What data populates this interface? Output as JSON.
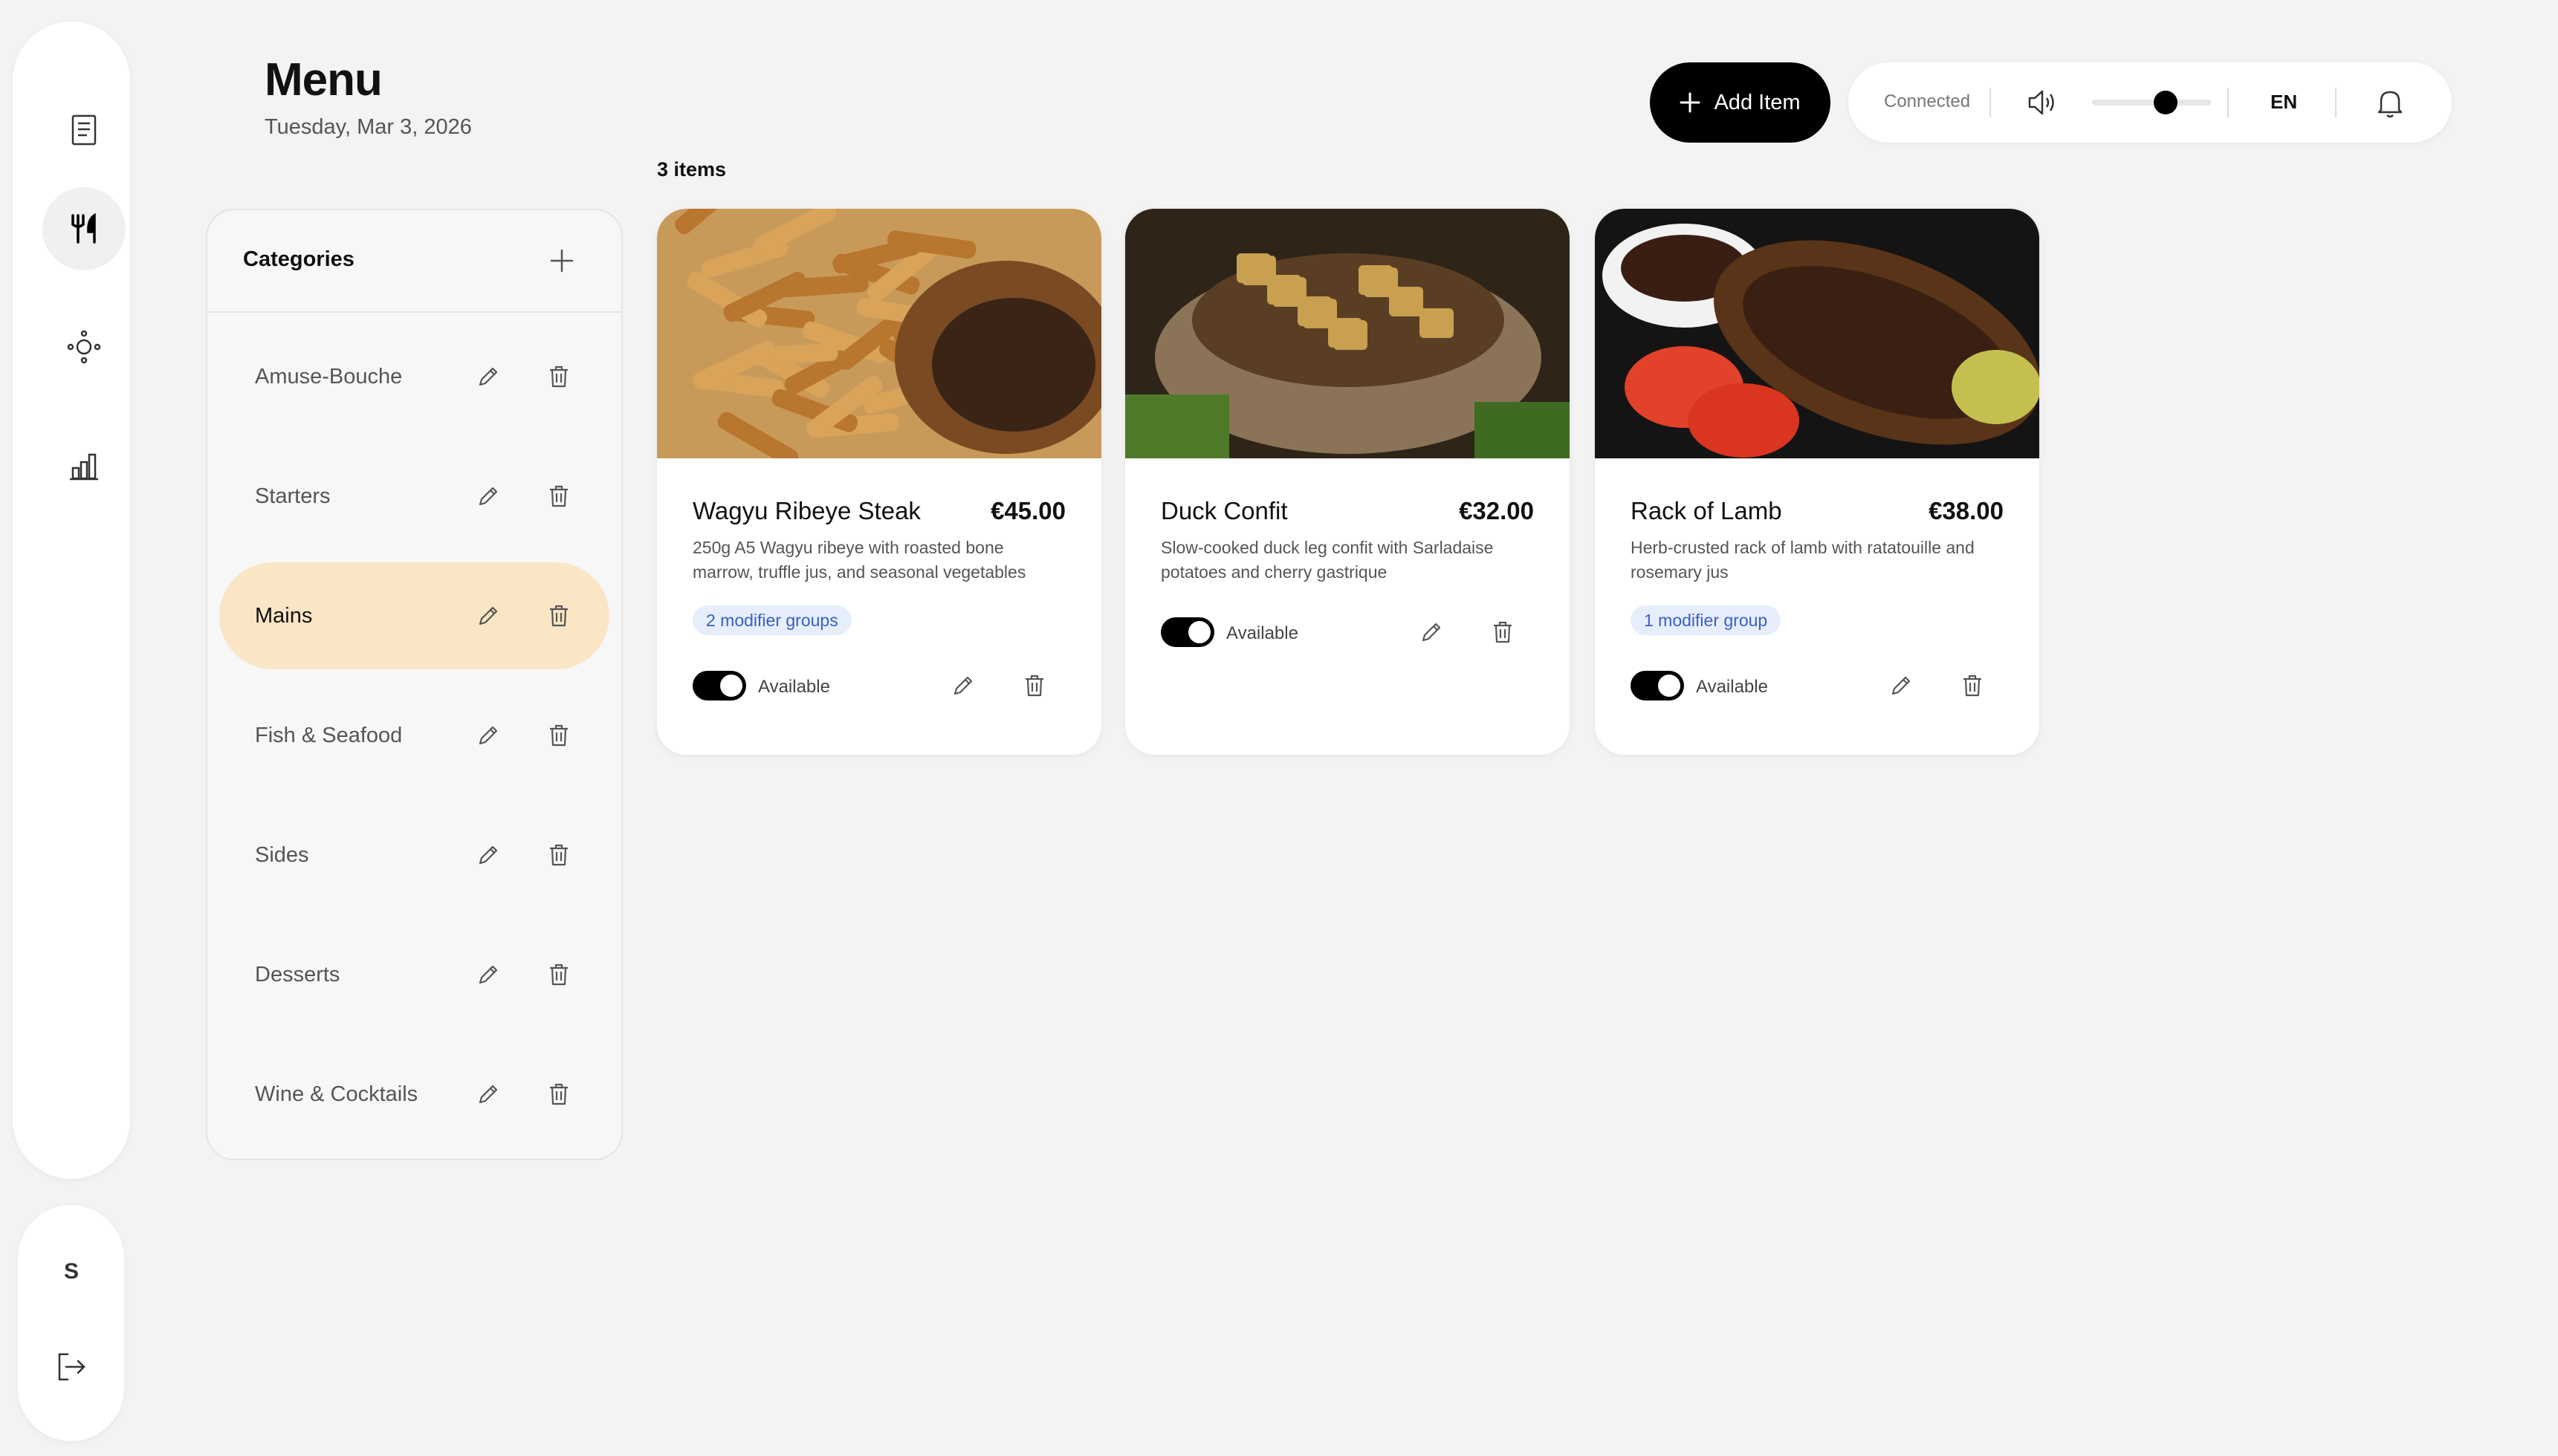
{
  "header": {
    "title": "Menu",
    "date": "Tuesday, Mar 3, 2026",
    "add_label": "Add Item",
    "status": "Connected",
    "language": "EN",
    "volume": 0.62
  },
  "nav": {
    "items": [
      {
        "icon": "receipt-icon"
      },
      {
        "icon": "utensils-icon",
        "active": true
      },
      {
        "icon": "network-icon"
      },
      {
        "icon": "bar-chart-icon"
      }
    ],
    "user_initial": "S"
  },
  "items_count": "3 items",
  "categories": {
    "title": "Categories",
    "items": [
      {
        "label": "Amuse-Bouche"
      },
      {
        "label": "Starters"
      },
      {
        "label": "Mains",
        "active": true
      },
      {
        "label": "Fish & Seafood"
      },
      {
        "label": "Sides"
      },
      {
        "label": "Desserts"
      },
      {
        "label": "Wine & Cocktails"
      }
    ]
  },
  "menu_items": [
    {
      "name": "Wagyu Ribeye Steak",
      "price": "€45.00",
      "description": "250g A5 Wagyu ribeye with roasted bone marrow, truffle jus, and seasonal vegetables",
      "badge": "2 modifier groups",
      "status": "Available",
      "available": true
    },
    {
      "name": "Duck Confit",
      "price": "€32.00",
      "description": "Slow-cooked duck leg confit with Sarladaise potatoes and cherry gastrique",
      "badge": "",
      "status": "Available",
      "available": true
    },
    {
      "name": "Rack of Lamb",
      "price": "€38.00",
      "description": "Herb-crusted rack of lamb with ratatouille and rosemary jus",
      "badge": "1 modifier group",
      "status": "Available",
      "available": true
    }
  ]
}
